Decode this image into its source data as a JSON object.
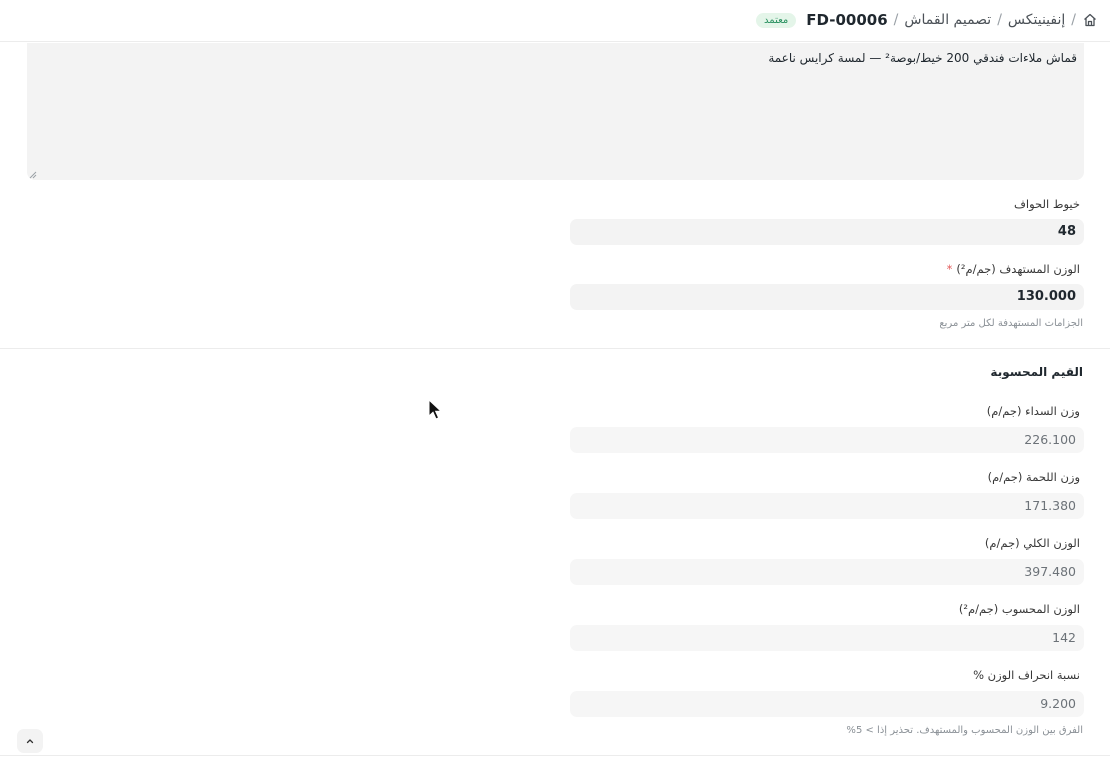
{
  "breadcrumb": {
    "items": [
      "إنفينيتكس",
      "تصميم القماش"
    ],
    "doc_id": "FD-00006",
    "status_badge": "معتمد",
    "separator": "/"
  },
  "description": {
    "value": "قماش ملاءات فندقي 200 خيط/بوصة² — لمسة كرايس ناعمة"
  },
  "fields": {
    "selvedge_threads": {
      "label": "خيوط الحواف",
      "value": "48"
    },
    "target_weight": {
      "label": "الوزن المستهدف (جم/م²)",
      "required_mark": "*",
      "value": "130.000",
      "description": "الجزامات المستهدفة لكل متر مربع"
    }
  },
  "computed": {
    "title": "القيم المحسوبة",
    "warp_weight": {
      "label": "وزن السداء (جم/م)",
      "value": "226.100"
    },
    "weft_weight": {
      "label": "وزن اللحمة (جم/م)",
      "value": "171.380"
    },
    "total_weight": {
      "label": "الوزن الكلي (جم/م)",
      "value": "397.480"
    },
    "calculated_weight": {
      "label": "الوزن المحسوب (جم/م²)",
      "value": "142"
    },
    "weight_deviation": {
      "label": "نسبة انحراف الوزن %",
      "value": "9.200",
      "description": "الفرق بين الوزن المحسوب والمستهدف. تحذير إذا > 5%"
    }
  },
  "colors": {
    "badge_bg": "#e4f5e9",
    "badge_text": "#278f5e",
    "required": "#e35b5b",
    "input_bg": "#f3f3f3"
  }
}
